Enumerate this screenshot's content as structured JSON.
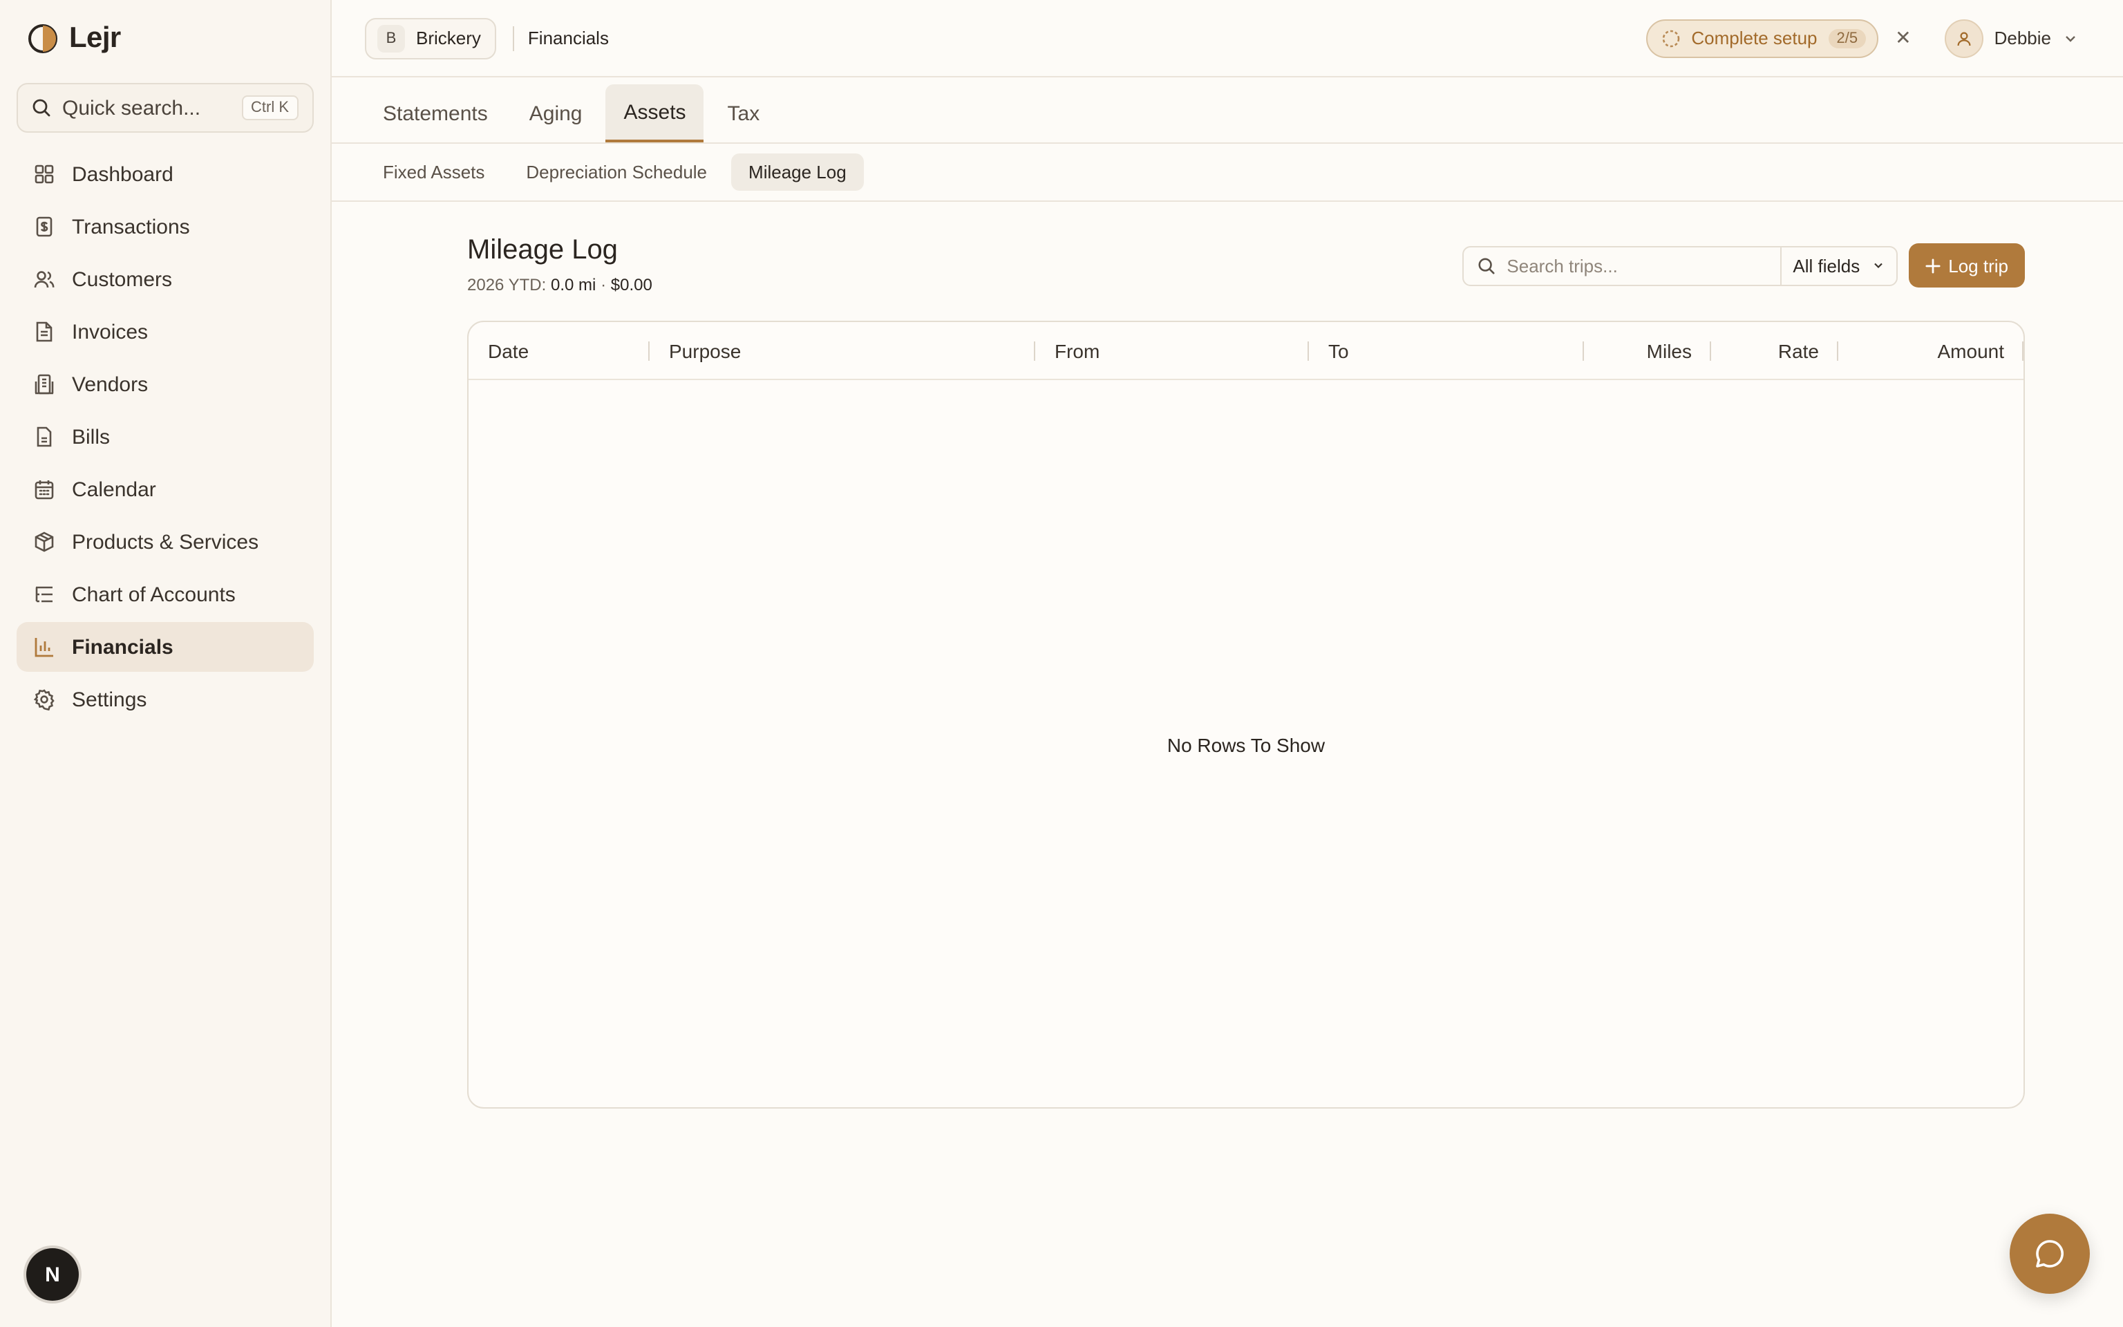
{
  "app": {
    "name": "Lejr"
  },
  "sidebar": {
    "search_placeholder": "Quick search...",
    "search_shortcut": "Ctrl K",
    "items": [
      {
        "label": "Dashboard",
        "icon": "grid-icon"
      },
      {
        "label": "Transactions",
        "icon": "dollar-doc-icon"
      },
      {
        "label": "Customers",
        "icon": "users-icon"
      },
      {
        "label": "Invoices",
        "icon": "document-icon"
      },
      {
        "label": "Vendors",
        "icon": "building-icon"
      },
      {
        "label": "Bills",
        "icon": "file-icon"
      },
      {
        "label": "Calendar",
        "icon": "calendar-icon"
      },
      {
        "label": "Products & Services",
        "icon": "package-icon"
      },
      {
        "label": "Chart of Accounts",
        "icon": "list-tree-icon"
      },
      {
        "label": "Financials",
        "icon": "bar-chart-icon",
        "active": true
      },
      {
        "label": "Settings",
        "icon": "gear-icon"
      }
    ],
    "footer_avatar": "N"
  },
  "topbar": {
    "company_initial": "B",
    "company_name": "Brickery",
    "breadcrumb": "Financials",
    "setup_label": "Complete setup",
    "setup_count": "2/5",
    "user_name": "Debbie"
  },
  "tabs": [
    "Statements",
    "Aging",
    "Assets",
    "Tax"
  ],
  "subtabs": [
    "Fixed Assets",
    "Depreciation Schedule",
    "Mileage Log"
  ],
  "page": {
    "title": "Mileage Log",
    "ytd_label": "2026 YTD:",
    "ytd_miles": "0.0 mi",
    "ytd_sep": "·",
    "ytd_amount": "$0.00",
    "search_placeholder": "Search trips...",
    "field_filter": "All fields",
    "log_button": "Log trip"
  },
  "grid": {
    "columns": [
      "Date",
      "Purpose",
      "From",
      "To",
      "Miles",
      "Rate",
      "Amount"
    ],
    "empty_text": "No Rows To Show"
  },
  "colors": {
    "accent": "#b07a3c",
    "sidebar_bg": "#faf6f0",
    "active_nav": "#f0e6da"
  }
}
